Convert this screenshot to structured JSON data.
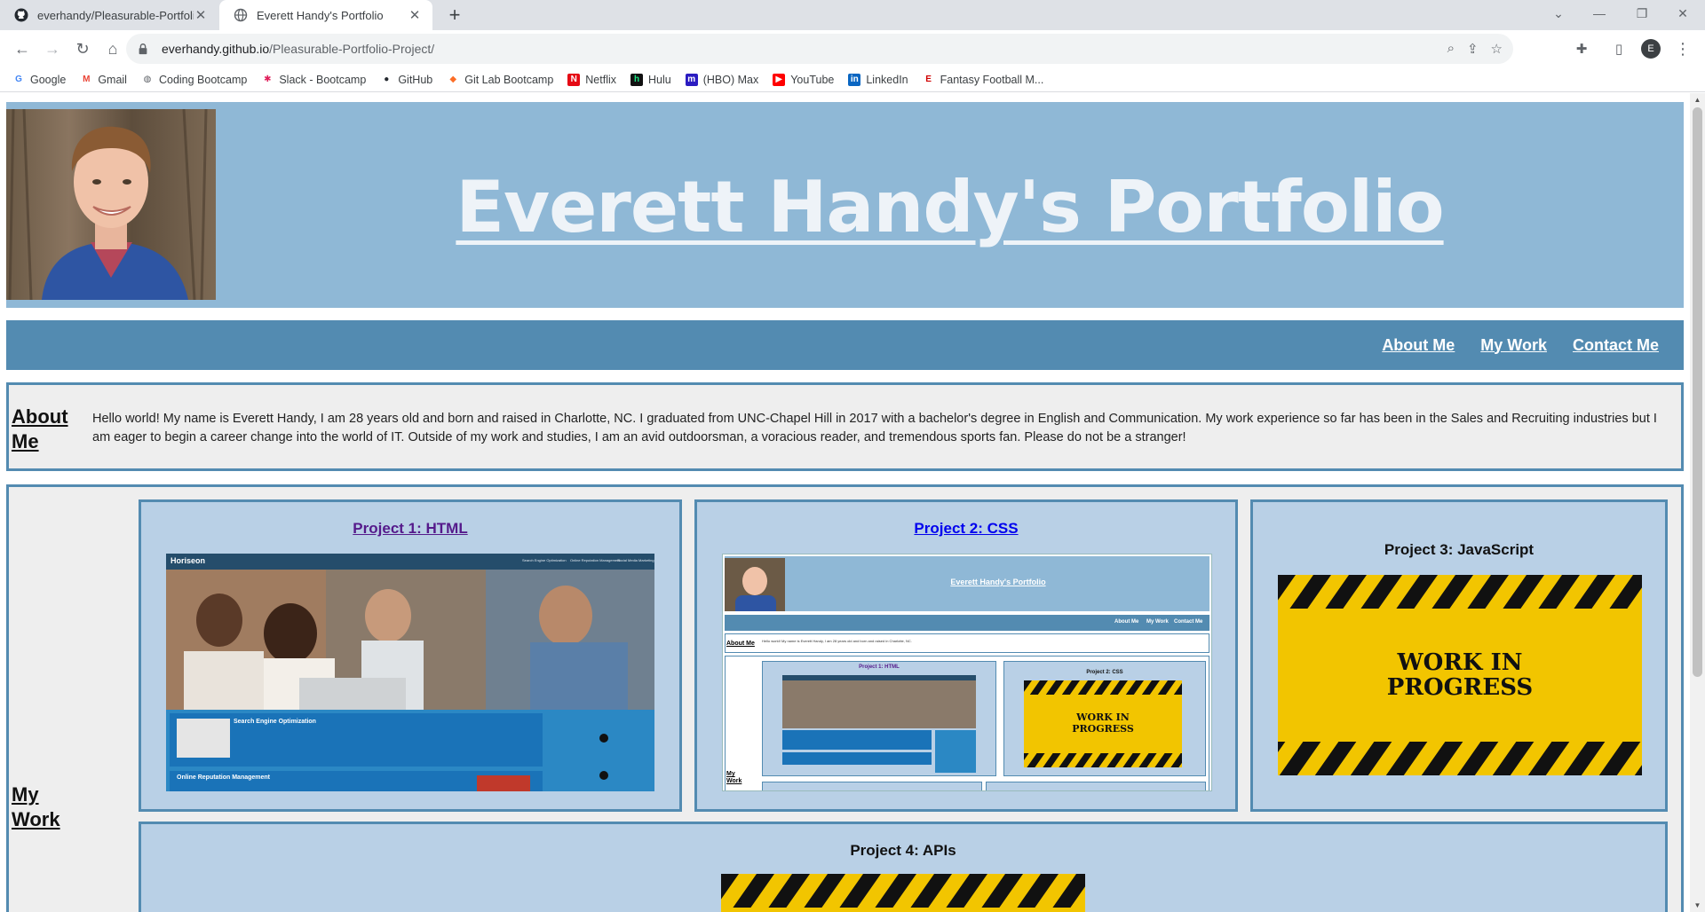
{
  "browser": {
    "tabs": [
      {
        "title": "everhandy/Pleasurable-Portfolio-",
        "active": false
      },
      {
        "title": "Everett Handy's Portfolio",
        "active": true
      }
    ],
    "url_host": "everhandy.github.io",
    "url_path": "/Pleasurable-Portfolio-Project/",
    "profile_initial": "E",
    "bookmarks": [
      {
        "label": "Google",
        "icon": "google-icon",
        "color": "#4285f4"
      },
      {
        "label": "Gmail",
        "icon": "gmail-icon",
        "color": "#ea4335"
      },
      {
        "label": "Coding Bootcamp",
        "icon": "globe-icon",
        "color": "#5f6368"
      },
      {
        "label": "Slack - Bootcamp",
        "icon": "slack-icon",
        "color": "#e01e5a"
      },
      {
        "label": "GitHub",
        "icon": "github-icon",
        "color": "#24292f"
      },
      {
        "label": "Git Lab Bootcamp",
        "icon": "gitlab-icon",
        "color": "#fc6d26"
      },
      {
        "label": "Netflix",
        "icon": "netflix-icon",
        "color": "#e50914"
      },
      {
        "label": "Hulu",
        "icon": "hulu-icon",
        "color": "#1ce783"
      },
      {
        "label": "(HBO) Max",
        "icon": "max-icon",
        "color": "#2b1cc1"
      },
      {
        "label": "YouTube",
        "icon": "youtube-icon",
        "color": "#ff0000"
      },
      {
        "label": "LinkedIn",
        "icon": "linkedin-icon",
        "color": "#0a66c2"
      },
      {
        "label": "Fantasy Football M...",
        "icon": "espn-icon",
        "color": "#d00000"
      }
    ]
  },
  "page": {
    "title": "Everett Handy's Portfolio",
    "nav": [
      "About Me",
      "My Work",
      "Contact Me"
    ],
    "about": {
      "label": "About Me",
      "text": "Hello world! My name is Everett Handy, I am 28 years old and born and raised in Charlotte, NC. I graduated from UNC-Chapel Hill in 2017 with a bachelor's degree in English and Communication. My work experience so far has been in the Sales and Recruiting industries but I am eager to begin a career change into the world of IT. Outside of my work and studies, I am an avid outdoorsman, a voracious reader, and tremendous sports fan. Please do not be a stranger!"
    },
    "work": {
      "label": "My Work",
      "projects": [
        {
          "title": "Project 1: HTML",
          "linked": true,
          "color": "#551a8b"
        },
        {
          "title": "Project 2: CSS",
          "linked": true,
          "color": "#0000ee"
        },
        {
          "title": "Project 3: JavaScript",
          "linked": false,
          "color": "#111111"
        },
        {
          "title": "Project 4: APIs",
          "linked": false,
          "color": "#111111"
        }
      ],
      "wip_line1": "WORK IN",
      "wip_line2": "PROGRESS"
    },
    "thumbs": {
      "horiseon_brand": "Horiseon",
      "horiseon_nav": [
        "Search Engine Optimization",
        "Online Reputation Management",
        "Social Media Marketing"
      ],
      "horiseon_sections": [
        "Search Engine Optimization",
        "Online Reputation Management"
      ],
      "mini_title": "Everett Handy's Portfolio",
      "mini_nav": [
        "About Me",
        "My Work",
        "Contact Me"
      ],
      "mini_about": "About Me",
      "mini_about_text": "Hello world! My name is Everett Handy, I am 28 years old and born and raised in Charlotte, NC.",
      "mini_mywork": "My Work",
      "mini_p1": "Project 1: HTML",
      "mini_p2": "Project 2: CSS"
    }
  },
  "colors": {
    "header_bg": "#8fb8d6",
    "nav_bg": "#538bb1",
    "card_bg": "#b9d0e6",
    "section_bg": "#eeeeee",
    "wip_yellow": "#f2c500"
  }
}
